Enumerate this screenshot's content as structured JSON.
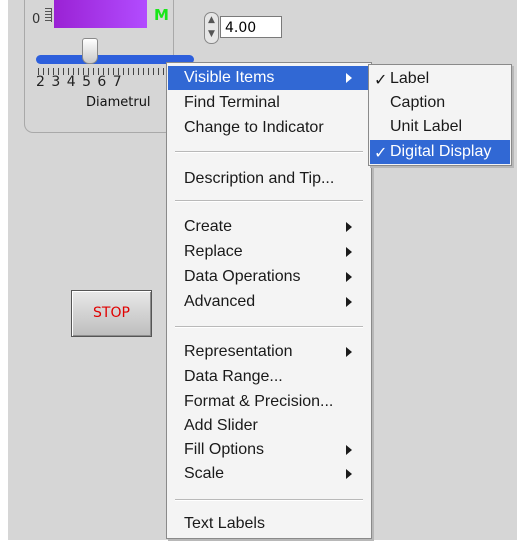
{
  "front_panel": {
    "tank_zero": "0",
    "tank_unit_letter": "M",
    "scale_labels": "2 3 4 5 6 7",
    "slider_label": "Diametrul",
    "numeric_value": "4.00",
    "stop_label": "STOP"
  },
  "context_menu": {
    "visible_items": "Visible Items",
    "find_terminal": "Find Terminal",
    "change_to_indicator": "Change to Indicator",
    "description_and_tip": "Description and Tip...",
    "create": "Create",
    "replace": "Replace",
    "data_operations": "Data Operations",
    "advanced": "Advanced",
    "representation": "Representation",
    "data_range": "Data Range...",
    "format_precision": "Format & Precision...",
    "add_slider": "Add Slider",
    "fill_options": "Fill Options",
    "scale": "Scale",
    "text_labels": "Text Labels"
  },
  "visible_items_submenu": {
    "check_mark": "✓",
    "label": "Label",
    "caption": "Caption",
    "unit_label": "Unit Label",
    "digital_display": "Digital Display",
    "label_checked": true,
    "caption_checked": false,
    "unit_label_checked": false,
    "digital_display_checked": true
  },
  "colors": {
    "menu_highlight": "#3168d4",
    "panel_background": "#d6d6d6",
    "tank_fill": "#b24cff",
    "stop_text": "#e00000",
    "indicator_green": "#19e619"
  }
}
